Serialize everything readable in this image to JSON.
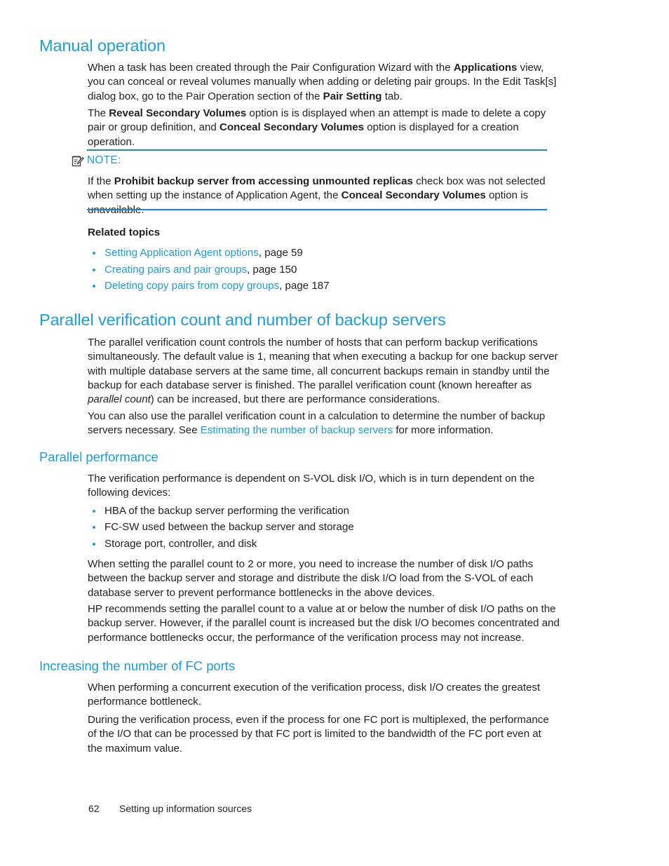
{
  "sections": {
    "manual_operation": {
      "heading": "Manual operation",
      "p1_a": "When a task has been created through the Pair Configuration Wizard with the ",
      "p1_b1": "Applications",
      "p1_c": " view, you can conceal or reveal volumes manually when adding or deleting pair groups. In the Edit Task[s] dialog box, go to the Pair Operation section of the ",
      "p1_b2": "Pair Setting",
      "p1_d": " tab.",
      "p2_a": "The ",
      "p2_b1": "Reveal Secondary Volumes",
      "p2_c": " option is is displayed when an attempt is made to delete a copy pair or group definition, and ",
      "p2_b2": "Conceal Secondary Volumes",
      "p2_d": " option is displayed for a creation operation."
    },
    "note": {
      "label": "NOTE:",
      "icon": "note-pencil-icon",
      "text_a": "If the ",
      "text_b1": "Prohibit backup server from accessing unmounted replicas",
      "text_c": " check box was not selected when setting up the instance of Application Agent, the ",
      "text_b2": "Conceal Secondary Volumes",
      "text_d": " option is unavailable."
    },
    "related_topics": {
      "heading": "Related topics",
      "items": [
        {
          "link": "Setting Application Agent options",
          "suffix": ", page 59"
        },
        {
          "link": "Creating pairs and pair groups",
          "suffix": ", page 150"
        },
        {
          "link": "Deleting copy pairs from copy groups",
          "suffix": ", page 187"
        }
      ]
    },
    "parallel_count": {
      "heading": "Parallel verification count and number of backup servers",
      "p1_a": "The parallel verification count controls the number of hosts that can perform backup verifications simultaneously. The default value is 1, meaning that when executing a backup for one backup server with multiple database servers at the same time, all concurrent backups remain in standby until the backup for each database server is finished. The parallel verification count (known hereafter as ",
      "p1_i": "parallel count",
      "p1_b": ") can be increased, but there are performance considerations.",
      "p2_a": "You can also use the parallel verification count in a calculation to determine the number of backup servers necessary. See ",
      "p2_link": "Estimating the number of backup servers",
      "p2_b": " for more information."
    },
    "parallel_performance": {
      "heading": "Parallel performance",
      "p1": "The verification performance is dependent on S-VOL disk I/O, which is in turn dependent on the following devices:",
      "bullets": [
        "HBA of the backup server performing the verification",
        "FC-SW used between the backup server and storage",
        "Storage port, controller, and disk"
      ],
      "p2": "When setting the parallel count to 2 or more, you need to increase the number of disk I/O paths between the backup server and storage and distribute the disk I/O load from the S-VOL of each database server to prevent performance bottlenecks in the above devices.",
      "p3": "HP recommends setting the parallel count to a value at or below the number of disk I/O paths on the backup server. However, if the parallel count is increased but the disk I/O becomes concentrated and performance bottlenecks occur, the performance of the verification process may not increase."
    },
    "fc_ports": {
      "heading": "Increasing the number of FC ports",
      "p1": "When performing a concurrent execution of the verification process, disk I/O creates the greatest performance bottleneck.",
      "p2": "During the verification process, even if the process for one FC port is multiplexed, the performance of the I/O that can be processed by that FC port is limited to the bandwidth of the FC port even at the maximum value."
    }
  },
  "footer": {
    "page_number": "62",
    "section_title": "Setting up information sources"
  },
  "colors": {
    "heading_blue": "#1b9dd9",
    "link_blue": "#1b9dd9",
    "rule_blue": "#1b87c2",
    "body_text": "#231f20"
  }
}
